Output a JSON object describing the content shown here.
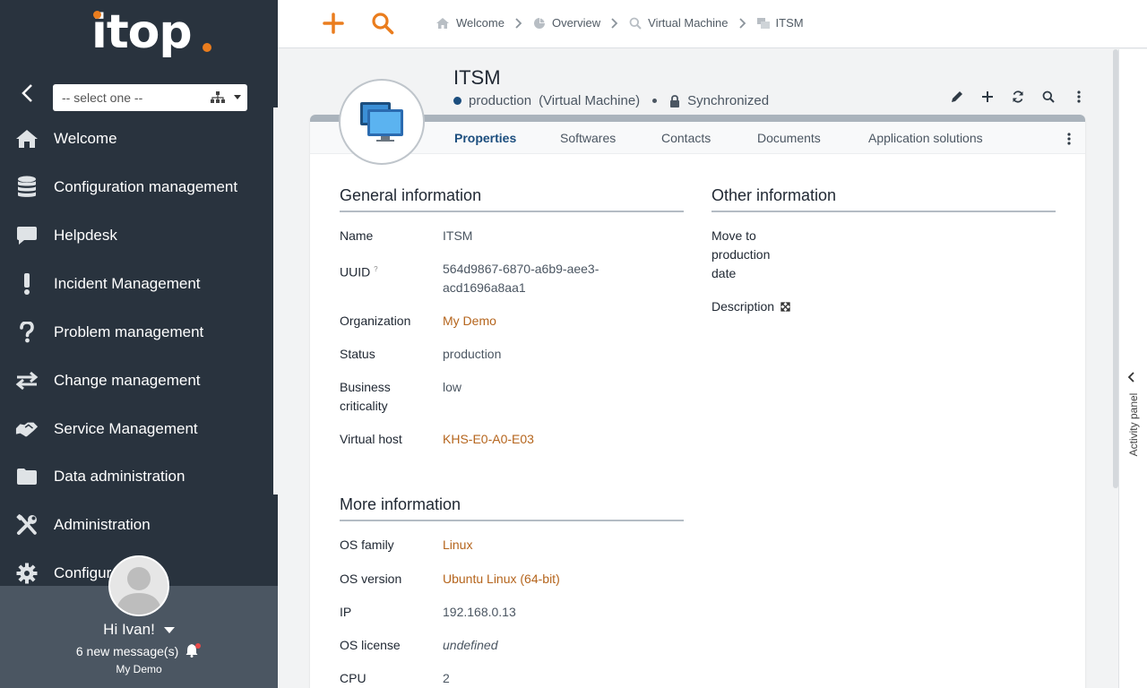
{
  "logo_text": "itop",
  "sidebar": {
    "org_select": "-- select one --",
    "items": [
      {
        "label": "Welcome"
      },
      {
        "label": "Configuration management"
      },
      {
        "label": "Helpdesk"
      },
      {
        "label": "Incident Management"
      },
      {
        "label": "Problem management"
      },
      {
        "label": "Change management"
      },
      {
        "label": "Service Management"
      },
      {
        "label": "Data administration"
      },
      {
        "label": "Administration"
      },
      {
        "label": "Configur"
      }
    ],
    "user": {
      "greeting": "Hi Ivan!",
      "messages": "6 new message(s)",
      "org": "My Demo"
    }
  },
  "breadcrumb": [
    {
      "label": "Welcome",
      "icon": "home-icon"
    },
    {
      "label": "Overview",
      "icon": "pie-chart-icon"
    },
    {
      "label": "Virtual Machine",
      "icon": "search-icon"
    },
    {
      "label": "ITSM",
      "icon": "windows-icon"
    }
  ],
  "object": {
    "title": "ITSM",
    "status": "production",
    "class": "(Virtual Machine)",
    "sync": "Synchronized"
  },
  "tabs": [
    {
      "label": "Properties"
    },
    {
      "label": "Softwares"
    },
    {
      "label": "Contacts"
    },
    {
      "label": "Documents"
    },
    {
      "label": "Application solutions"
    }
  ],
  "general": {
    "title": "General information",
    "name_label": "Name",
    "name_value": "ITSM",
    "uuid_label": "UUID",
    "uuid_sup": "?",
    "uuid_value_1": "564d9867-6870-a6b9-aee3-",
    "uuid_value_2": "acd1696a8aa1",
    "org_label": "Organization",
    "org_value": "My Demo",
    "status_label": "Status",
    "status_value": "production",
    "crit_label_1": "Business",
    "crit_label_2": "criticality",
    "crit_value": "low",
    "host_label": "Virtual host",
    "host_value": "KHS-E0-A0-E03"
  },
  "other": {
    "title": "Other information",
    "move_1": "Move to",
    "move_2": "production",
    "move_3": "date",
    "desc_label": "Description"
  },
  "more": {
    "title": "More information",
    "osfam_label": "OS family",
    "osfam_value": "Linux",
    "osver_label": "OS version",
    "osver_value": "Ubuntu Linux (64-bit)",
    "ip_label": "IP",
    "ip_value": "192.168.0.13",
    "lic_label": "OS license",
    "lic_value": "undefined",
    "cpu_label": "CPU",
    "cpu_value": "2"
  },
  "activity_panel": "Activity panel",
  "colors": {
    "accent": "#ea7d1e",
    "sidebar": "#29333e",
    "link": "#b5651d",
    "active_tab": "#1c4e7e"
  }
}
